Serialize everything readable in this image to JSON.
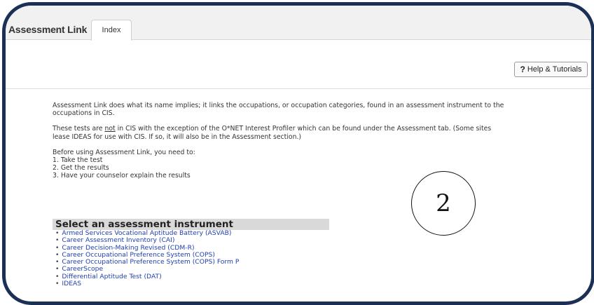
{
  "header": {
    "app_title": "Assessment Link",
    "tabs": [
      {
        "label": "Index"
      }
    ]
  },
  "help_button": {
    "icon": "question-mark-icon",
    "icon_glyph": "?",
    "label": "Help & Tutorials"
  },
  "intro": {
    "paragraph1": "Assessment Link does what its name implies; it links the occupations, or occupation categories, found in an assessment instrument to the occupations in CIS.",
    "paragraph2_before": "These tests are ",
    "paragraph2_emph": "not",
    "paragraph2_after": " in CIS with the exception of the O*NET Interest Profiler which can be found under the Assessment tab. (Some sites lease IDEAS for use with CIS. If so, it will also be in the Assessment section.)",
    "steps_title": "Before using Assessment Link, you need to:",
    "steps": [
      "1. Take the test",
      "2. Get the results",
      "3. Have your counselor explain the results"
    ]
  },
  "instrument_panel": {
    "heading": "Select an assessment instrument",
    "items": [
      "Armed Services Vocational Aptitude Battery (ASVAB)",
      "Career Assessment Inventory (CAI)",
      "Career Decision-Making Revised (CDM-R)",
      "Career Occupational Preference System (COPS)",
      "Career Occupational Preference System (COPS) Form P",
      "CareerScope",
      "Differential Aptitude Test (DAT)",
      "IDEAS"
    ]
  },
  "annotation": {
    "label": "2"
  },
  "colors": {
    "frame_border": "#1c2f55",
    "link": "#1f3fb4",
    "panel_header": "#d9d9d9",
    "topbar": "#f1f1f1"
  }
}
